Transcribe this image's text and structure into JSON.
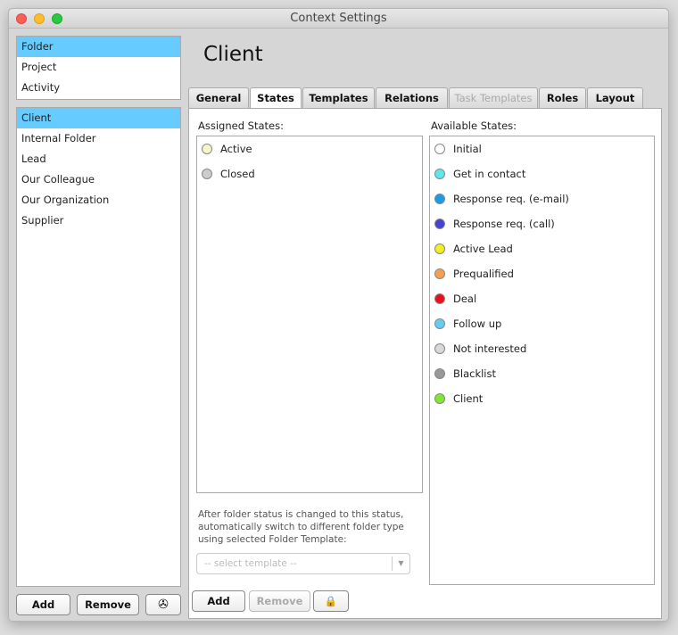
{
  "window": {
    "title": "Context Settings"
  },
  "sidebar": {
    "top_items": [
      {
        "label": "Folder",
        "selected": true
      },
      {
        "label": "Project"
      },
      {
        "label": "Activity"
      }
    ],
    "types": [
      {
        "label": "Client",
        "selected": true
      },
      {
        "label": "Internal Folder"
      },
      {
        "label": "Lead"
      },
      {
        "label": "Our Colleague"
      },
      {
        "label": "Our Organization"
      },
      {
        "label": "Supplier"
      }
    ],
    "add_label": "Add",
    "remove_label": "Remove",
    "tools_icon": "wrench-icon"
  },
  "main": {
    "title": "Client",
    "tabs": [
      {
        "label": "General"
      },
      {
        "label": "States",
        "active": true
      },
      {
        "label": "Templates"
      },
      {
        "label": "Relations"
      },
      {
        "label": "Task Templates",
        "disabled": true
      },
      {
        "label": "Roles"
      },
      {
        "label": "Layout"
      }
    ],
    "assigned_label": "Assigned States:",
    "assigned": [
      {
        "label": "Active",
        "color": "#f5f5c8"
      },
      {
        "label": "Closed",
        "color": "#cccccc"
      }
    ],
    "available_label": "Available States:",
    "available": [
      {
        "label": "Initial",
        "color": "#ffffff"
      },
      {
        "label": "Get in contact",
        "color": "#5ee8e8"
      },
      {
        "label": "Response req. (e-mail)",
        "color": "#1a9be8"
      },
      {
        "label": "Response req. (call)",
        "color": "#4444cc"
      },
      {
        "label": "Active Lead",
        "color": "#f0f020"
      },
      {
        "label": "Prequalified",
        "color": "#f5a050"
      },
      {
        "label": "Deal",
        "color": "#e8101a"
      },
      {
        "label": "Follow up",
        "color": "#66ccf0"
      },
      {
        "label": "Not interested",
        "color": "#d8d8d8"
      },
      {
        "label": "Blacklist",
        "color": "#999999"
      },
      {
        "label": "Client",
        "color": "#80e830"
      }
    ],
    "description": "After folder status is changed to this status, automatically switch to different folder type using selected Folder Template:",
    "template_placeholder": "-- select template --",
    "add_label": "Add",
    "remove_label": "Remove",
    "lock_icon": "lock-icon"
  }
}
